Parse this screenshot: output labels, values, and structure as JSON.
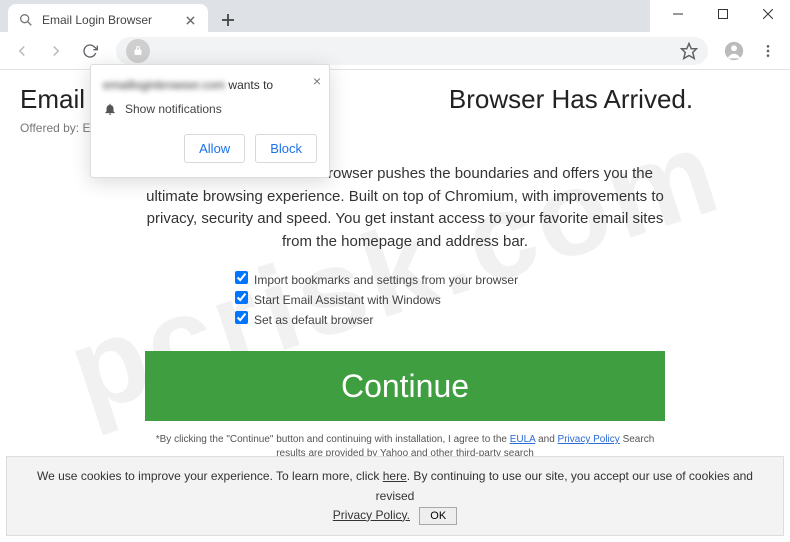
{
  "window": {
    "close": "✕",
    "maximize": "▢",
    "minimize": "—"
  },
  "tab": {
    "title": "Email Login Browser"
  },
  "page_heading_visible": "Email As",
  "page_heading_right": "Browser Has Arrived.",
  "offered": "Offered by: Emai",
  "description": "Email Assistant Internet Browser pushes the boundaries and offers you the ultimate browsing experience. Built on top of Chromium, with improvements to privacy, security and speed. You get instant access to your favorite email sites from the homepage and address bar.",
  "checks": [
    "Import bookmarks and settings from your browser",
    "Start Email Assistant with Windows",
    "Set as default browser"
  ],
  "cta": "Continue",
  "fineprint": {
    "prefix": "*By clicking the \"Continue\" button and continuing with installation, I agree to the ",
    "eula": "EULA",
    "mid": " and ",
    "privacy": "Privacy Policy",
    "suffix": " Search results are provided by Yahoo and other third-party search"
  },
  "notify": {
    "origin": "emailloginbrowser.com",
    "wants": " wants to",
    "message": "Show notifications",
    "allow": "Allow",
    "block": "Block"
  },
  "cookie": {
    "a": "We use cookies to improve your experience. To learn more, click ",
    "here": "here",
    "b": ". By continuing to use our site, you accept our use of cookies and revised ",
    "pp": "Privacy Policy.",
    "ok": "OK"
  },
  "watermark": "pcrisk.com"
}
